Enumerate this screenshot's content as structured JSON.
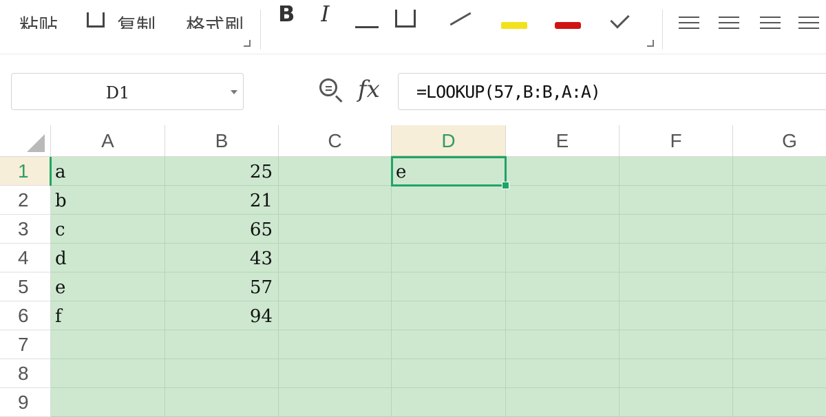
{
  "ribbon": {
    "paste_label": "粘贴",
    "copy_label": "复制",
    "format_painter_label": "格式刷"
  },
  "name_box": {
    "value": "D1"
  },
  "formula_bar": {
    "formula": "=LOOKUP(57,B:B,A:A)"
  },
  "columns": [
    "A",
    "B",
    "C",
    "D",
    "E",
    "F",
    "G"
  ],
  "active_column": "D",
  "rows": [
    "1",
    "2",
    "3",
    "4",
    "5",
    "6",
    "7",
    "8",
    "9"
  ],
  "active_row": "1",
  "cells": {
    "A1": "a",
    "B1": "25",
    "D1": "e",
    "A2": "b",
    "B2": "21",
    "A3": "c",
    "B3": "65",
    "A4": "d",
    "B4": "43",
    "A5": "e",
    "B5": "57",
    "A6": "f",
    "B6": "94"
  },
  "selected_cell": "D1",
  "colors": {
    "cell_fill": "#cde8cf",
    "selection": "#21a365",
    "active_header": "#f7eed9",
    "highlight_swatch": "#f2e21c",
    "font_color_swatch": "#d01414"
  }
}
